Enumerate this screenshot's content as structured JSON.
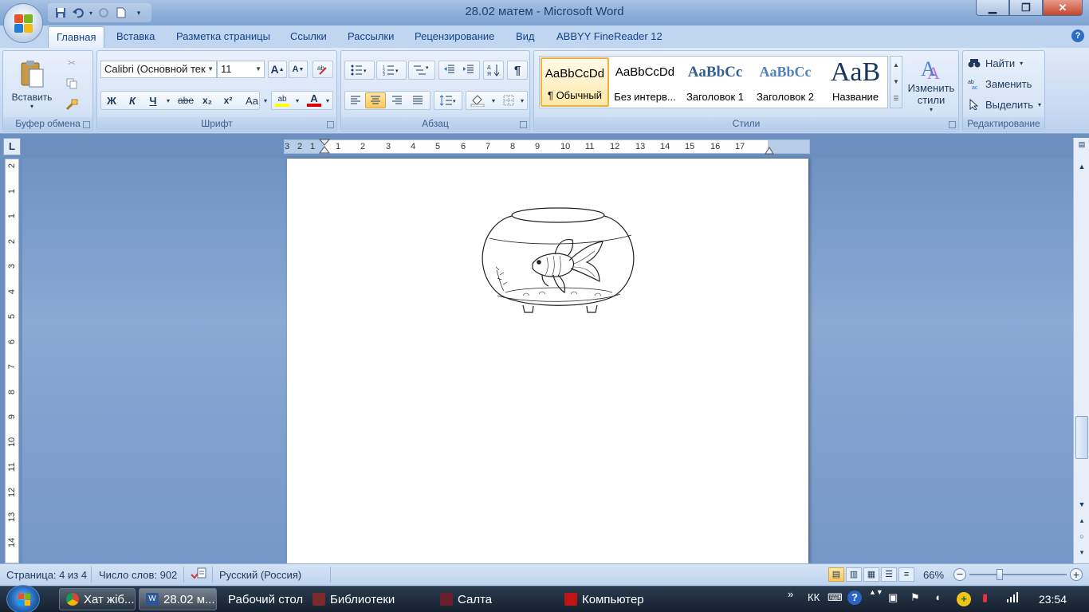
{
  "window": {
    "title": "28.02 матем - Microsoft Word",
    "min": "▁",
    "max": "❐",
    "close": "✕"
  },
  "qat": {
    "save_icon": "save-icon",
    "undo_icon": "undo-icon",
    "redo_icon": "redo-icon",
    "new_icon": "new-document-icon"
  },
  "tabs": [
    "Главная",
    "Вставка",
    "Разметка страницы",
    "Ссылки",
    "Рассылки",
    "Рецензирование",
    "Вид",
    "ABBYY FineReader 12"
  ],
  "ribbon": {
    "clipboard": {
      "label": "Буфер обмена",
      "paste": "Вставить"
    },
    "font": {
      "label": "Шрифт",
      "name": "Calibri (Основной тек",
      "size": "11",
      "bold": "Ж",
      "italic": "К",
      "underline": "Ч",
      "strike": "abe",
      "sub": "x₂",
      "sup": "x²",
      "case": "Aa",
      "grow": "A",
      "shrink": "A",
      "highlight": "ab",
      "fontcolor": "A"
    },
    "paragraph": {
      "label": "Абзац"
    },
    "styles": {
      "label": "Стили",
      "items": [
        {
          "preview": "AaBbCcDd",
          "name": "¶ Обычный"
        },
        {
          "preview": "AaBbCcDd",
          "name": "Без интерв..."
        },
        {
          "preview": "AaBbCc",
          "name": "Заголовок 1"
        },
        {
          "preview": "AaBbCc",
          "name": "Заголовок 2"
        },
        {
          "preview": "AaB",
          "name": "Название"
        }
      ],
      "change_line1": "Изменить",
      "change_line2": "стили"
    },
    "editing": {
      "label": "Редактирование",
      "find": "Найти",
      "replace": "Заменить",
      "select": "Выделить"
    }
  },
  "ruler": {
    "corner": "L",
    "h_ticks": [
      "3",
      "2",
      "1",
      "1",
      "2",
      "3",
      "4",
      "5",
      "6",
      "7",
      "8",
      "9",
      "10",
      "11",
      "12",
      "13",
      "14",
      "15",
      "16",
      "17"
    ],
    "v_ticks": [
      "2",
      "1",
      "1",
      "2",
      "3",
      "4",
      "5",
      "6",
      "7",
      "8",
      "9",
      "10",
      "11",
      "12",
      "13",
      "14"
    ]
  },
  "status": {
    "page": "Страница: 4 из 4",
    "words": "Число слов: 902",
    "language": "Русский (Россия)",
    "zoom": "66%",
    "zoom_level_percent": 66
  },
  "taskbar": {
    "items": [
      {
        "label": "Хат жіб...",
        "icon": "chrome-icon"
      },
      {
        "label": "28.02 м...",
        "icon": "word-icon"
      },
      {
        "label": "Рабочий стол",
        "icon": ""
      },
      {
        "label": "Библиотеки",
        "icon": "library-icon"
      },
      {
        "label": "Салта",
        "icon": "folder-icon"
      },
      {
        "label": "Компьютер",
        "icon": "computer-icon"
      }
    ],
    "lang": "КК",
    "time": "23:54"
  },
  "colors": {
    "ribbon_bg": "#c8daf2",
    "doc_bg": "#7597c8",
    "taskbar_bg": "#1b2a3c",
    "accent_selected": "#fbc760",
    "highlight_yellow": "#ffff00",
    "font_red": "#e00000"
  }
}
